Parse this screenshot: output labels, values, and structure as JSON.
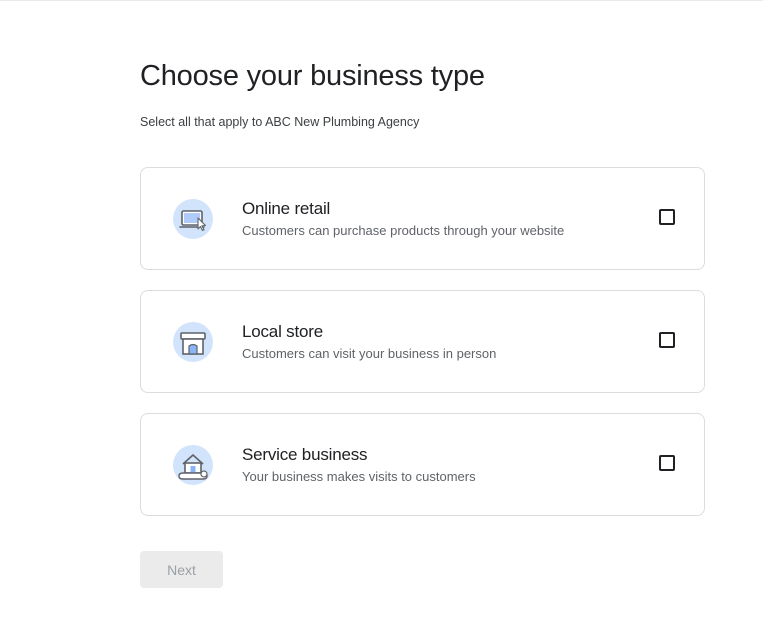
{
  "header": {
    "title": "Choose your business type",
    "subtitle": "Select all that apply to ABC New Plumbing Agency"
  },
  "options": [
    {
      "icon": "online-retail-icon",
      "label": "Online retail",
      "description": "Customers can purchase products through your website",
      "checked": false
    },
    {
      "icon": "storefront-icon",
      "label": "Local store",
      "description": "Customers can visit your business in person",
      "checked": false
    },
    {
      "icon": "home-service-icon",
      "label": "Service business",
      "description": "Your business makes visits to customers",
      "checked": false
    }
  ],
  "actions": {
    "next_label": "Next",
    "next_enabled": false
  },
  "colors": {
    "icon_bg": "#d2e3fc",
    "icon_stroke": "#5f6368",
    "icon_accent": "#8ab4f8",
    "border": "#dadce0",
    "disabled_bg": "#ebebeb",
    "disabled_text": "#9aa0a6"
  }
}
